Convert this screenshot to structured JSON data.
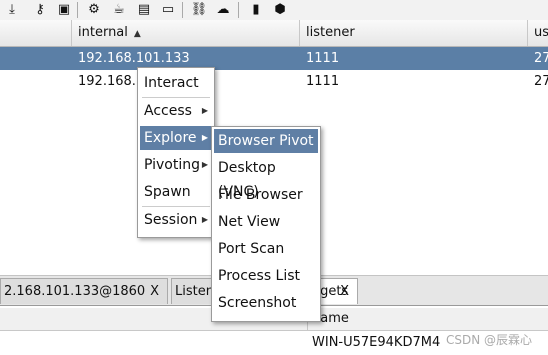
{
  "toolbar": {
    "icons": [
      "download-icon",
      "key-icon",
      "image-icon",
      "gear-icon",
      "coffee-icon",
      "document-icon",
      "terminal-icon",
      "link-icon",
      "cloud-icon",
      "book-icon",
      "package-icon"
    ]
  },
  "beacons_table": {
    "columns": [
      {
        "label": "internal",
        "sort": "ascending"
      },
      {
        "label": "listener"
      },
      {
        "label": "us"
      }
    ],
    "rows": [
      {
        "internal": "192.168.101.133",
        "listener": "1111",
        "user": "27",
        "selected": true
      },
      {
        "internal": "192.168.1",
        "listener": "1111",
        "user": "27",
        "selected": false
      }
    ]
  },
  "context_menu": {
    "items": [
      "Interact",
      "Access",
      "Explore",
      "Pivoting",
      "Spawn",
      "Session"
    ],
    "active": "Explore"
  },
  "explore_submenu": {
    "items": [
      "Browser Pivot",
      "Desktop (VNC)",
      "File Browser",
      "Net View",
      "Port Scan",
      "Process List",
      "Screenshot"
    ],
    "active": "Browser Pivot"
  },
  "tabs": [
    {
      "label": "2.168.101.133@1860",
      "close": "X"
    },
    {
      "label": "Listen",
      "close": ""
    },
    {
      "label": "argets",
      "close": "X"
    }
  ],
  "bottom_table": {
    "column": "name",
    "value": "WIN-U57E94KD7M4"
  },
  "watermark": "CSDN @辰霖心"
}
